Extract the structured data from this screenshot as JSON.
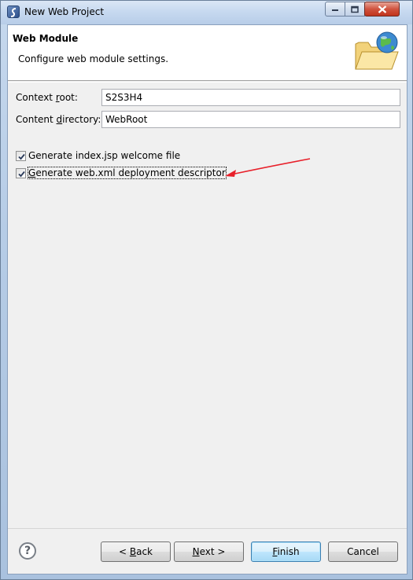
{
  "window": {
    "title": "New Web Project"
  },
  "header": {
    "title": "Web Module",
    "description": "Configure web module settings."
  },
  "form": {
    "context_root": {
      "label_pre": "Context ",
      "label_mnemonic": "r",
      "label_post": "oot:",
      "value": "S2S3H4"
    },
    "content_directory": {
      "label_pre": "Content ",
      "label_mnemonic": "d",
      "label_post": "irectory:",
      "value": "WebRoot"
    }
  },
  "options": [
    {
      "label": "Generate index.jsp welcome file",
      "checked": true
    },
    {
      "label_mnemonic": "G",
      "label_rest": "enerate web.xml deployment descriptor",
      "checked": true
    }
  ],
  "buttons": {
    "back_prefix": "< ",
    "back_mnemonic": "B",
    "back_rest": "ack",
    "next_mnemonic": "N",
    "next_rest": "ext >",
    "finish_mnemonic": "F",
    "finish_rest": "inish",
    "cancel": "Cancel"
  },
  "colors": {
    "annotation_arrow": "#e8202a",
    "default_button_border": "#3c7fb1"
  }
}
